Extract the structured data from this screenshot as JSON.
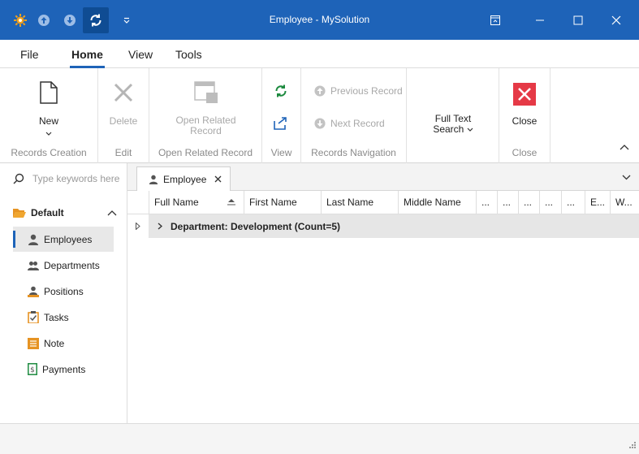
{
  "window": {
    "title": "Employee - MySolution"
  },
  "colors": {
    "accent": "#1e63b8",
    "title_bar": "#1e63b8",
    "close_red": "#e53946"
  },
  "menu": {
    "tabs": [
      {
        "label": "File"
      },
      {
        "label": "Home"
      },
      {
        "label": "View"
      },
      {
        "label": "Tools"
      }
    ],
    "active": "Home"
  },
  "ribbon": {
    "new_label": "New",
    "records_creation_label": "Records Creation",
    "delete_label": "Delete",
    "edit_label": "Edit",
    "open_related_line1": "Open Related",
    "open_related_line2": "Record",
    "open_related_group_label": "Open Related Record",
    "view_group_label": "View",
    "previous_record_label": "Previous Record",
    "next_record_label": "Next Record",
    "records_navigation_label": "Records Navigation",
    "full_text_line1": "Full Text",
    "full_text_line2": "Search",
    "close_label": "Close",
    "close_group_label": "Close"
  },
  "nav": {
    "search_placeholder": "Type keywords here",
    "group_label": "Default",
    "items": [
      {
        "label": "Employees",
        "icon": "employee-icon"
      },
      {
        "label": "Departments",
        "icon": "departments-icon"
      },
      {
        "label": "Positions",
        "icon": "positions-icon"
      },
      {
        "label": "Tasks",
        "icon": "tasks-icon"
      },
      {
        "label": "Note",
        "icon": "note-icon"
      },
      {
        "label": "Payments",
        "icon": "payments-icon"
      }
    ]
  },
  "doc_tab": {
    "label": "Employee"
  },
  "grid": {
    "columns": [
      {
        "label": "Full Name"
      },
      {
        "label": "First Name"
      },
      {
        "label": "Last Name"
      },
      {
        "label": "Middle Name"
      },
      {
        "label": "..."
      },
      {
        "label": "..."
      },
      {
        "label": "..."
      },
      {
        "label": "..."
      },
      {
        "label": "..."
      },
      {
        "label": "E..."
      },
      {
        "label": "W..."
      }
    ],
    "group_row": "Department: Development (Count=5)"
  }
}
